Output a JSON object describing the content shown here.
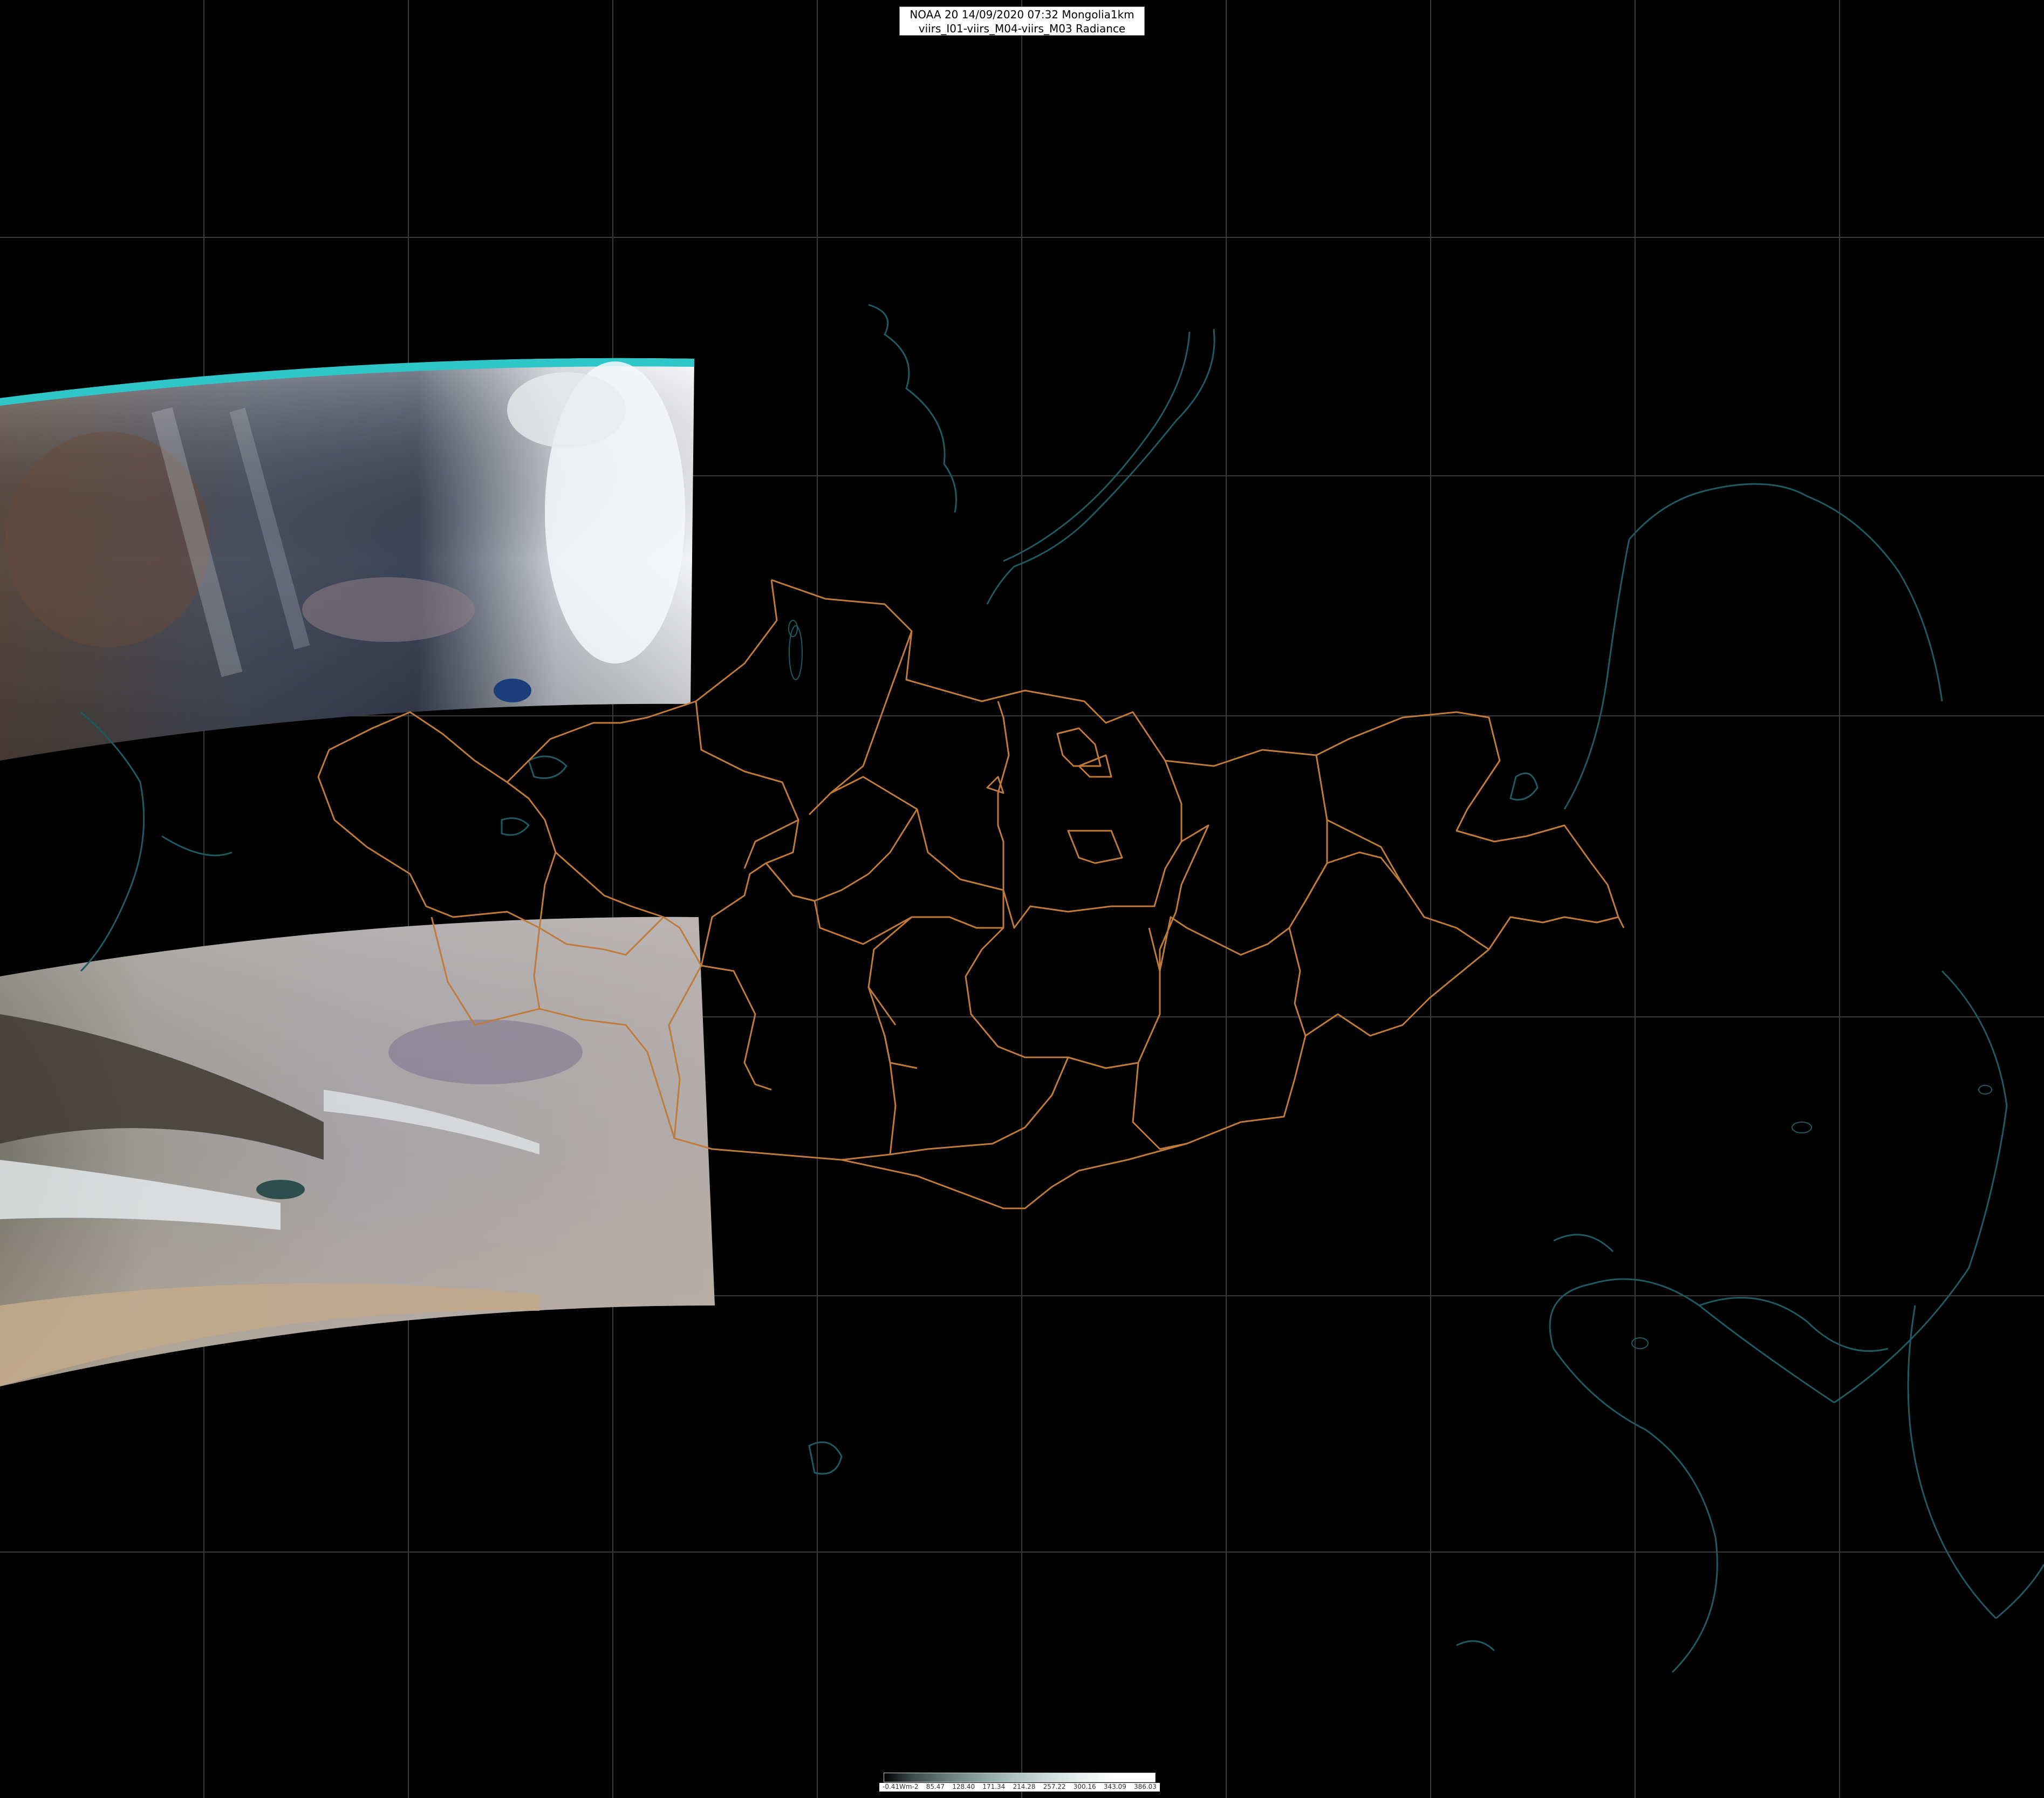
{
  "title": {
    "line1": "NOAA 20 14/09/2020 07:32 Mongolia1km",
    "line2": "viirs_I01-viirs_M04-viirs_M03 Radiance"
  },
  "legend": {
    "labels": [
      "-0.41Wm-2",
      "85.47",
      "128.40",
      "171.34",
      "214.28",
      "257.22",
      "300.16",
      "343.09",
      "386.03"
    ]
  },
  "colors": {
    "background": "#000000",
    "graticule": "#3a3a3a",
    "coastline": "#1f5a63",
    "admin_border": "#c07a3a"
  }
}
